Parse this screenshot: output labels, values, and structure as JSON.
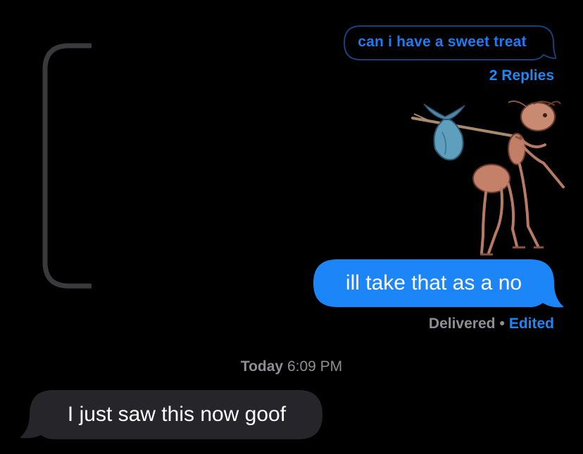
{
  "colors": {
    "background": "#000000",
    "sent_bubble": "#1c85f8",
    "received_bubble": "#26262a",
    "link_blue": "#1f86f5",
    "secondary_gray": "#8e8e93",
    "thread_bracket": "#3a3a3c"
  },
  "thread_reply": {
    "quoted_text": "can i have a sweet treat",
    "replies_label": "2 Replies"
  },
  "sticker": {
    "icon": "ant-with-bindle-sticker"
  },
  "sent_message": {
    "text": "ill take that as a no",
    "status_delivered": "Delivered",
    "status_separator": "•",
    "status_edited": "Edited"
  },
  "timestamp": {
    "day": "Today",
    "time": "6:09 PM"
  },
  "received_message": {
    "text": "I just saw this now goof"
  }
}
